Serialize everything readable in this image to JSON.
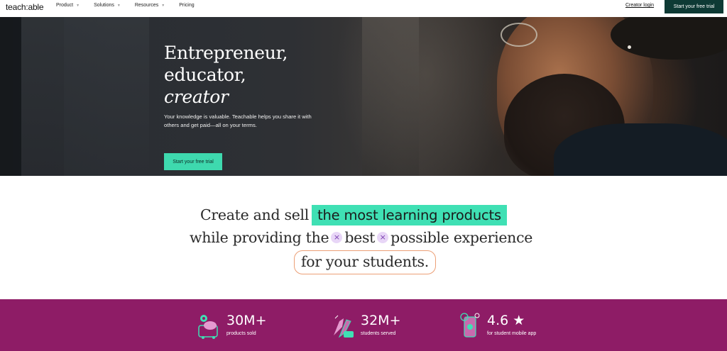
{
  "nav": {
    "logo": "teach:able",
    "menu": [
      {
        "label": "Product",
        "has_dropdown": true
      },
      {
        "label": "Solutions",
        "has_dropdown": true
      },
      {
        "label": "Resources",
        "has_dropdown": true
      },
      {
        "label": "Pricing",
        "has_dropdown": false
      }
    ],
    "login": "Creator login",
    "cta": "Start your free trial",
    "dropdown_icon": "chevron-down-icon"
  },
  "hero": {
    "title_line1": "Entrepreneur,",
    "title_line2": "educator,",
    "title_line3": "creator",
    "subtitle": "Your knowledge is valuable. Teachable helps you share it with others and get paid—all on your terms.",
    "cta": "Start your free trial"
  },
  "tagline": {
    "line1_prefix": "Create and sell",
    "line1_highlight": "the most learning products",
    "line2_a": "while providing the",
    "line2_b": "best",
    "line2_c": "possible experience",
    "line3": "for your students.",
    "strike_glyph": "×"
  },
  "stats": [
    {
      "value": "30M+",
      "label": "products sold",
      "icon": "cart-icon"
    },
    {
      "value": "32M+",
      "label": "students served",
      "icon": "hands-icon"
    },
    {
      "value": "4.6 ★",
      "label": "for student mobile app",
      "icon": "phone-icon"
    }
  ],
  "colors": {
    "accent_green": "#3fe0b4",
    "dark_teal": "#0e3a35",
    "stats_purple": "#8e1c66",
    "outline_orange": "#ec9f76",
    "strike_lilac": "#e8d6f7"
  }
}
